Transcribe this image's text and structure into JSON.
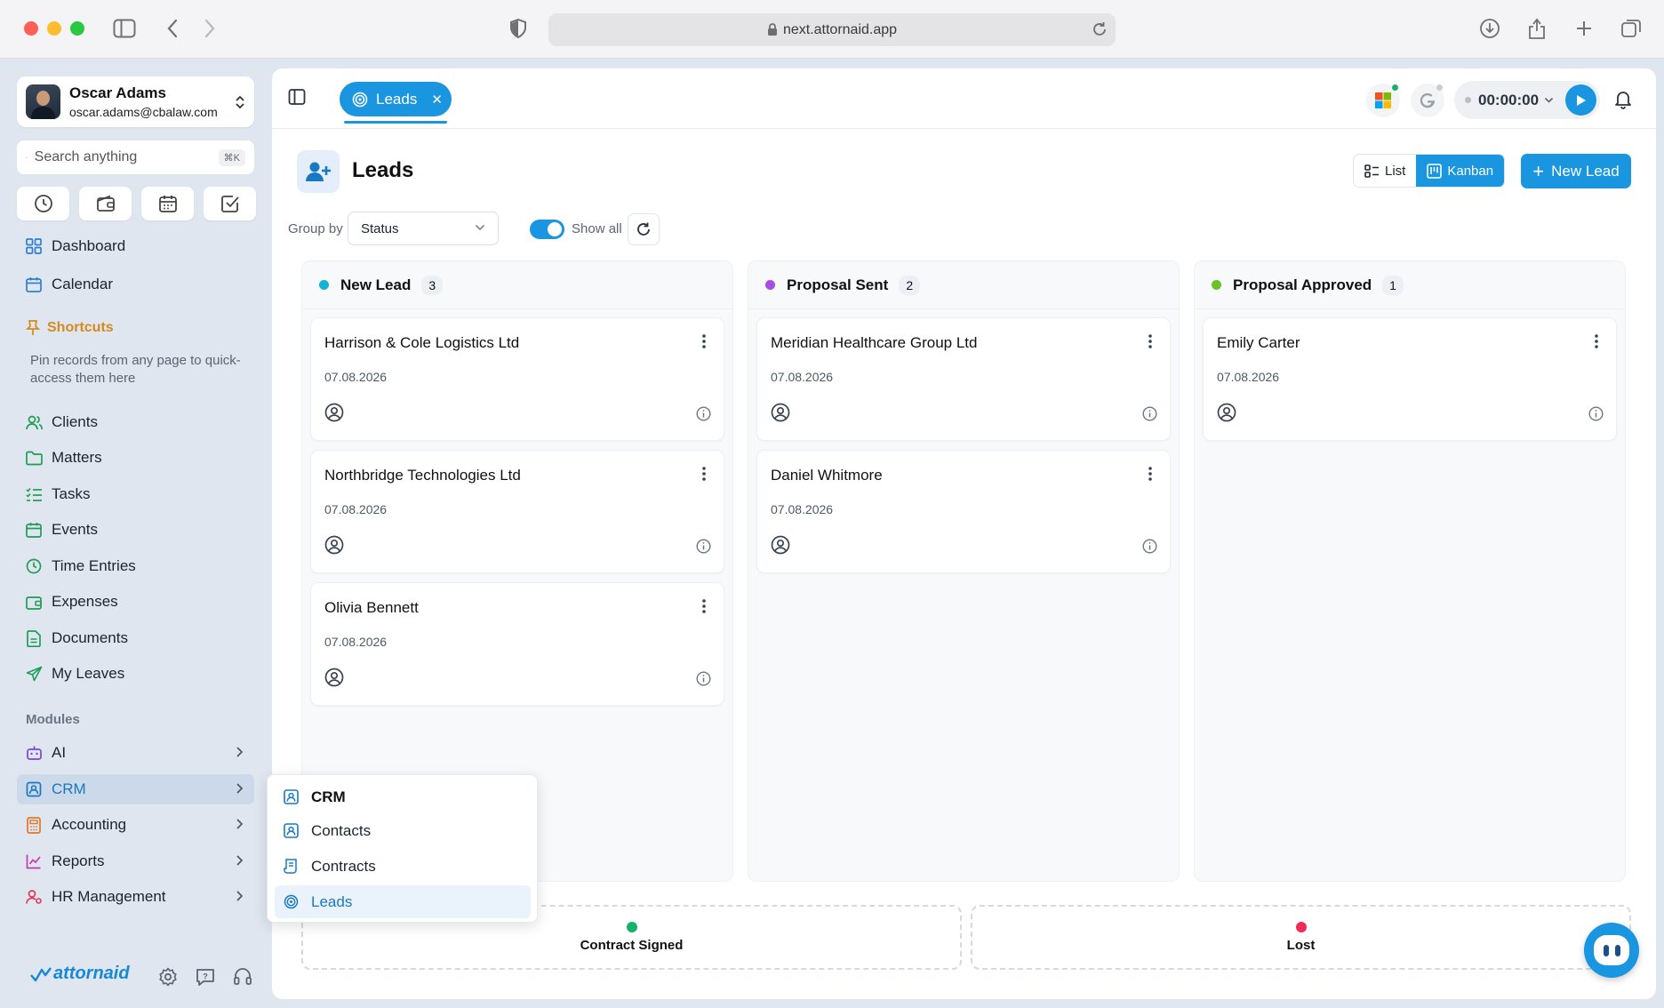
{
  "browser": {
    "url": "next.attornaid.app"
  },
  "user": {
    "name": "Oscar Adams",
    "email": "oscar.adams@cbalaw.com"
  },
  "search": {
    "placeholder": "Search anything",
    "shortcut": "⌘K"
  },
  "nav": {
    "dashboard": "Dashboard",
    "calendar": "Calendar",
    "shortcuts_title": "Shortcuts",
    "shortcuts_hint": "Pin records from any page to quick-access them here",
    "clients": "Clients",
    "matters": "Matters",
    "tasks": "Tasks",
    "events": "Events",
    "time_entries": "Time Entries",
    "expenses": "Expenses",
    "documents": "Documents",
    "my_leaves": "My Leaves",
    "modules_title": "Modules",
    "ai": "AI",
    "crm": "CRM",
    "accounting": "Accounting",
    "reports": "Reports",
    "hr_management": "HR Management"
  },
  "brand": {
    "name": "attornaid"
  },
  "flyout": {
    "header": "CRM",
    "contacts": "Contacts",
    "contracts": "Contracts",
    "leads": "Leads"
  },
  "topbar": {
    "tab_label": "Leads",
    "timer": "00:00:00"
  },
  "page": {
    "title": "Leads",
    "view_list": "List",
    "view_kanban": "Kanban",
    "new_lead": "New Lead",
    "group_by_label": "Group by",
    "group_by_value": "Status",
    "show_all": "Show all"
  },
  "columns": [
    {
      "title": "New Lead",
      "count": "3",
      "color": "#12b3d6",
      "cards": [
        {
          "name": "Harrison & Cole Logistics Ltd",
          "date": "07.08.2026"
        },
        {
          "name": "Northbridge Technologies Ltd",
          "date": "07.08.2026"
        },
        {
          "name": "Olivia Bennett",
          "date": "07.08.2026"
        }
      ]
    },
    {
      "title": "Proposal Sent",
      "count": "2",
      "color": "#a54ee6",
      "cards": [
        {
          "name": "Meridian Healthcare Group Ltd",
          "date": "07.08.2026"
        },
        {
          "name": "Daniel Whitmore",
          "date": "07.08.2026"
        }
      ]
    },
    {
      "title": "Proposal Approved",
      "count": "1",
      "color": "#6bc22b",
      "cards": [
        {
          "name": "Emily Carter",
          "date": "07.08.2026"
        }
      ]
    }
  ],
  "drop_zones": [
    {
      "label": "Contract Signed",
      "color": "#13b36a"
    },
    {
      "label": "Lost",
      "color": "#ee2d55"
    }
  ],
  "colors": {
    "accent": "#1a95e0",
    "shortcuts": "#d58a1c"
  }
}
